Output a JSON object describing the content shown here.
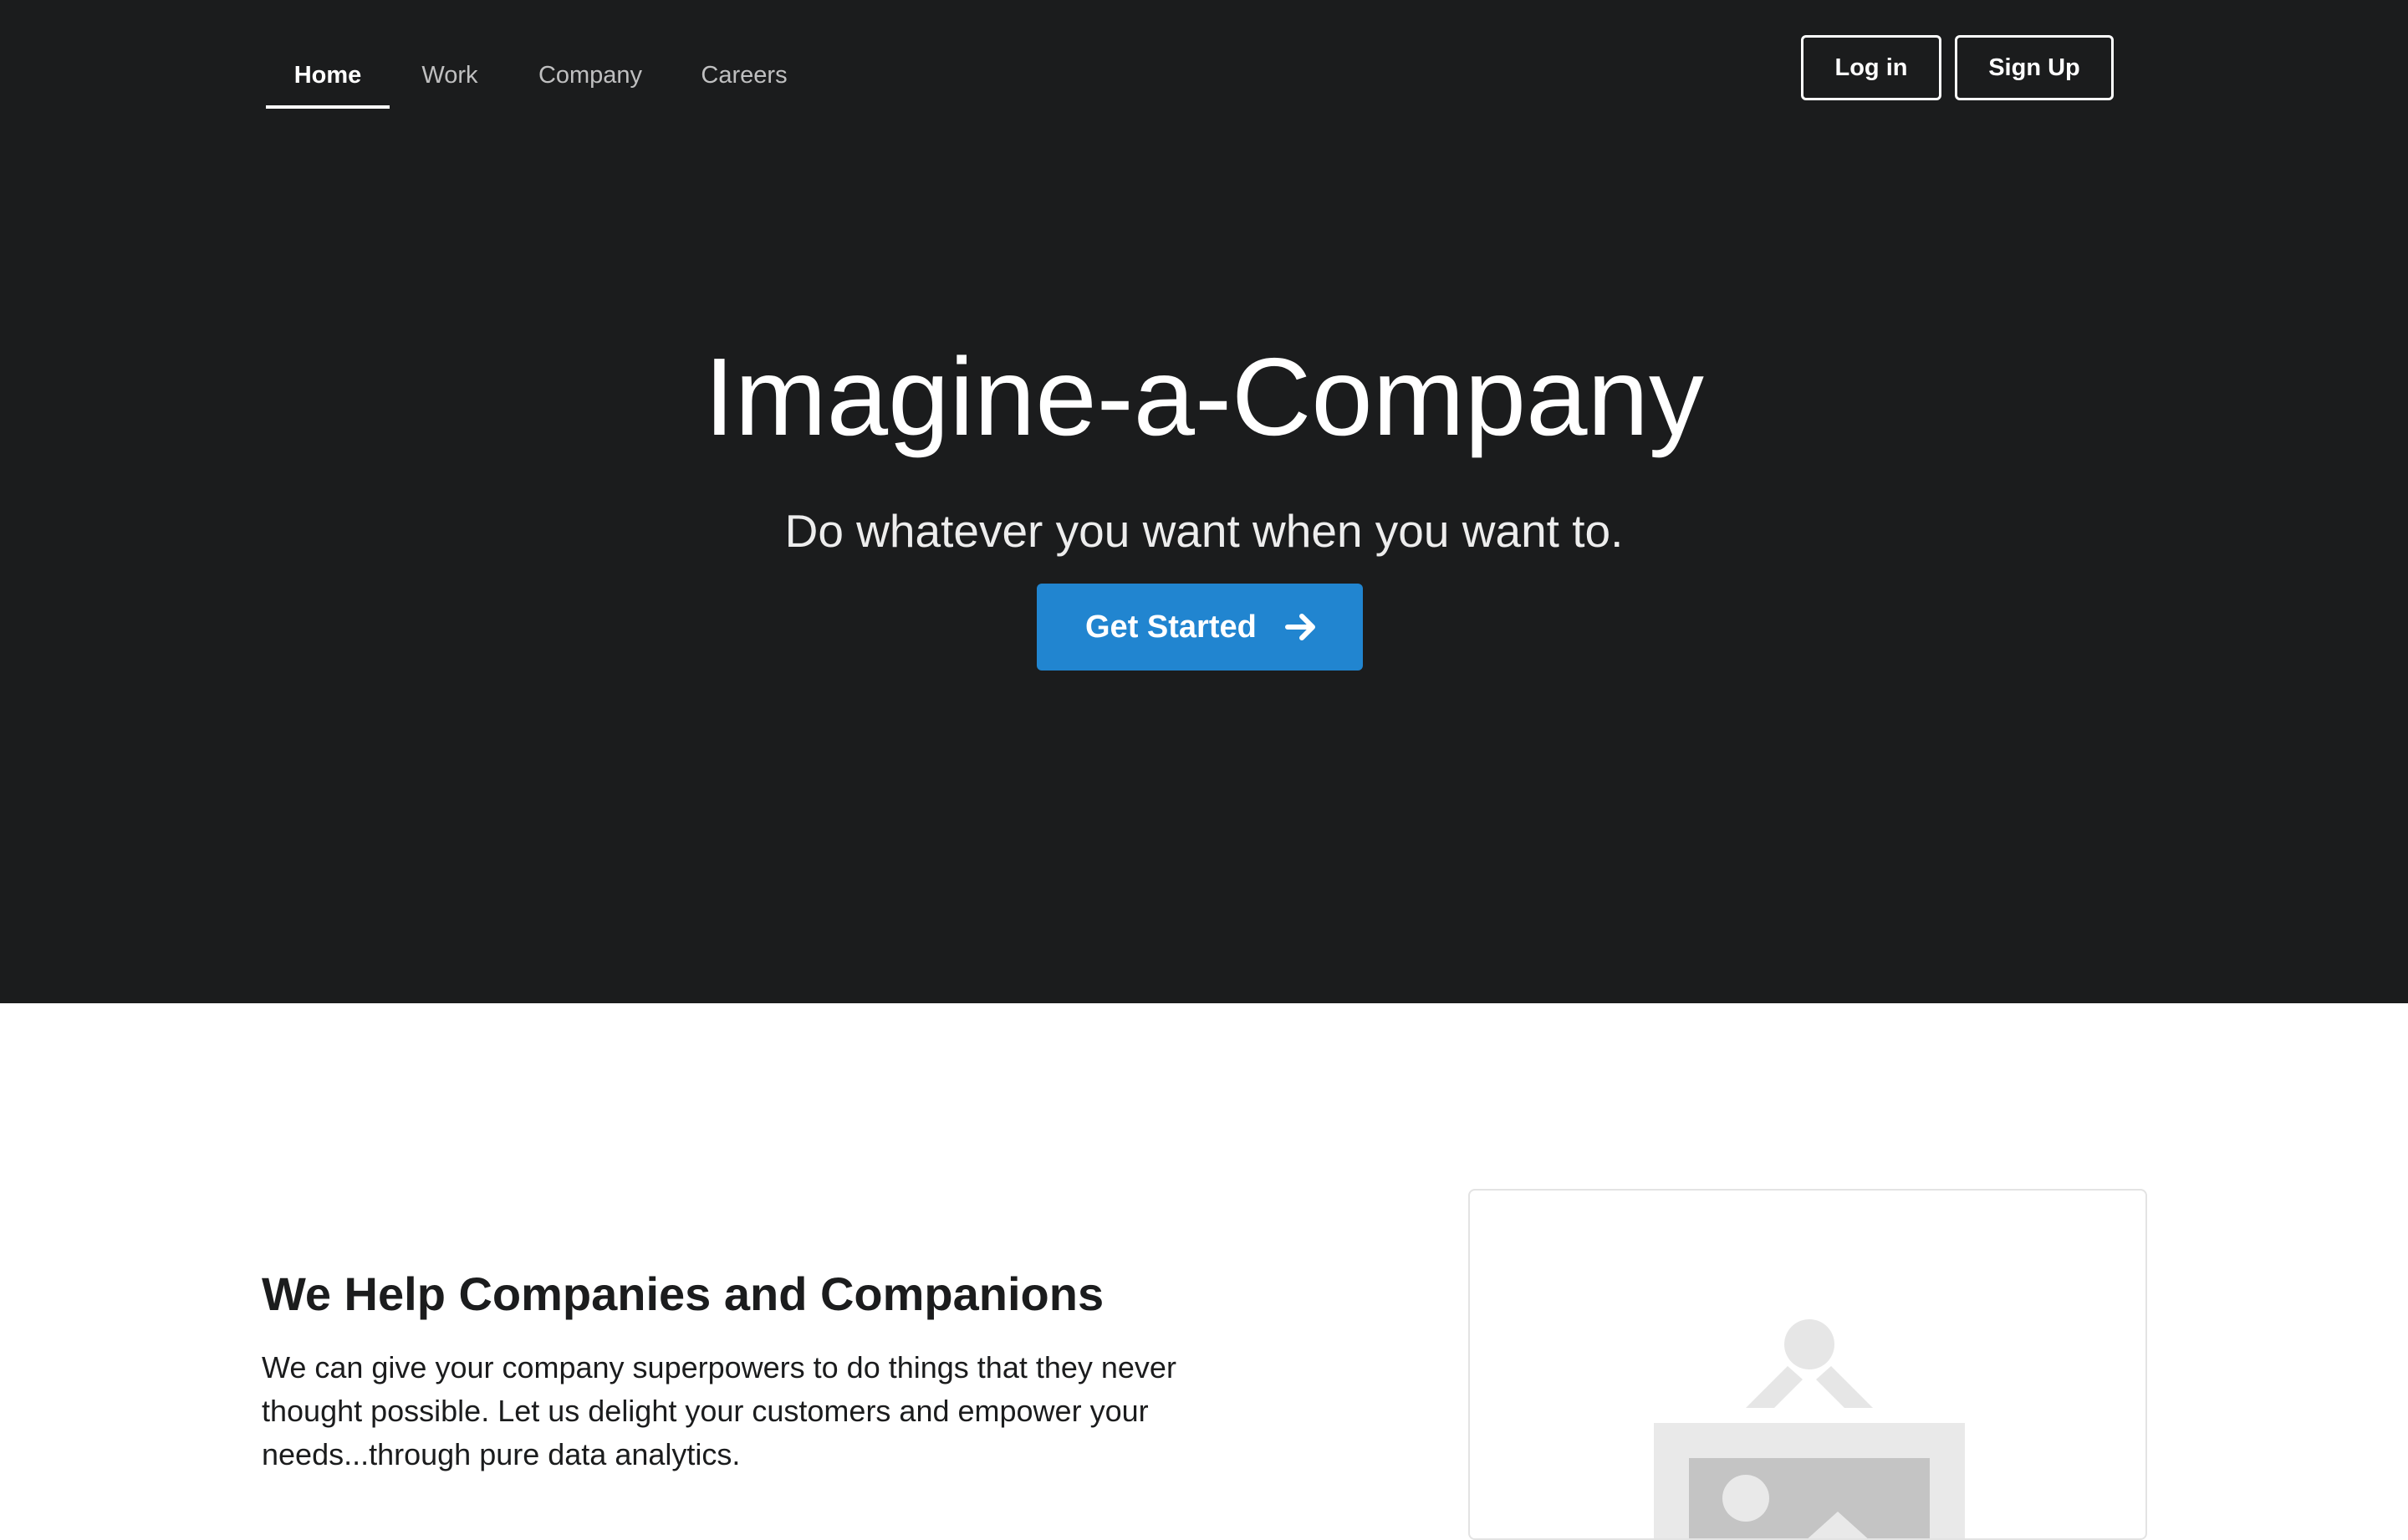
{
  "nav": {
    "items": [
      {
        "label": "Home",
        "active": true
      },
      {
        "label": "Work",
        "active": false
      },
      {
        "label": "Company",
        "active": false
      },
      {
        "label": "Careers",
        "active": false
      }
    ],
    "login_label": "Log in",
    "signup_label": "Sign Up"
  },
  "hero": {
    "title": "Imagine-a-Company",
    "subtitle": "Do whatever you want when you want to.",
    "cta_label": "Get Started",
    "cta_icon": "arrow-right-icon"
  },
  "section": {
    "heading": "We Help Companies and Companions",
    "body": "We can give your company superpowers to do things that they never thought possible. Let us delight your customers and empower your needs...through pure data analytics.",
    "image_icon": "image-placeholder-icon"
  },
  "colors": {
    "masthead_background": "#1b1c1d",
    "primary_button": "#2185d0",
    "text_dark": "#1b1c1d"
  }
}
